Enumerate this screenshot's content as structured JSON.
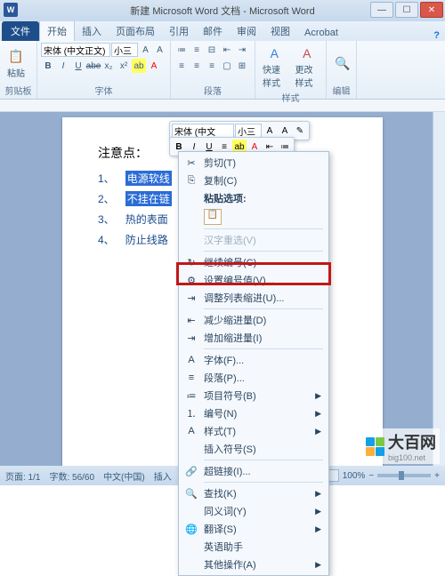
{
  "window": {
    "title": "新建 Microsoft Word 文档 - Microsoft Word",
    "app_icon": "W"
  },
  "tabs": {
    "file": "文件",
    "items": [
      "开始",
      "插入",
      "页面布局",
      "引用",
      "邮件",
      "审阅",
      "视图",
      "Acrobat"
    ],
    "help_icon": "?"
  },
  "ribbon": {
    "clipboard": {
      "label": "剪贴板",
      "paste": "粘贴"
    },
    "font": {
      "label": "字体",
      "name": "宋体 (中文正文)",
      "size": "小三",
      "bold": "B",
      "italic": "I",
      "underline": "U",
      "strike": "abe",
      "sub": "x₂",
      "sup": "x²"
    },
    "paragraph": {
      "label": "段落"
    },
    "styles": {
      "label": "样式",
      "quick": "快速样式",
      "change": "更改样式"
    },
    "editing": {
      "label": "编辑"
    }
  },
  "document": {
    "heading": "注意点：",
    "items": [
      {
        "num": "1、",
        "text": "电源软线"
      },
      {
        "num": "2、",
        "text": "不挂在链"
      },
      {
        "num": "3、",
        "text": "热的表面"
      },
      {
        "num": "4、",
        "text": "防止线路"
      }
    ]
  },
  "mini_toolbar": {
    "font": "宋体 (中文",
    "size": "小三",
    "format_painter": "✎"
  },
  "context_menu": {
    "cut": "剪切(T)",
    "copy": "复制(C)",
    "paste_header": "粘贴选项:",
    "ime": "汉字重选(V)",
    "restart_num": "继续编号(C)",
    "set_num_value": "设置编号值(V)...",
    "adjust_indent": "调整列表缩进(U)...",
    "decrease_indent": "减少缩进量(D)",
    "increase_indent": "增加缩进量(I)",
    "font_menu": "字体(F)...",
    "paragraph_menu": "段落(P)...",
    "bullets": "项目符号(B)",
    "numbering": "编号(N)",
    "styles_menu": "样式(T)",
    "insert_symbol": "插入符号(S)",
    "hyperlink": "超链接(I)...",
    "lookup": "查找(K)",
    "synonyms": "同义词(Y)",
    "translate": "翻译(S)",
    "english_assistant": "英语助手",
    "other_ops": "其他操作(A)"
  },
  "statusbar": {
    "page": "页面: 1/1",
    "words": "字数: 56/60",
    "language": "中文(中国)",
    "insert": "插入",
    "zoom": "100%"
  },
  "watermark": {
    "brand": "大百网",
    "url": "big100.net"
  },
  "colors": {
    "logo": [
      "#13a0e8",
      "#7ac943",
      "#fbb03b",
      "#13a0e8"
    ]
  }
}
